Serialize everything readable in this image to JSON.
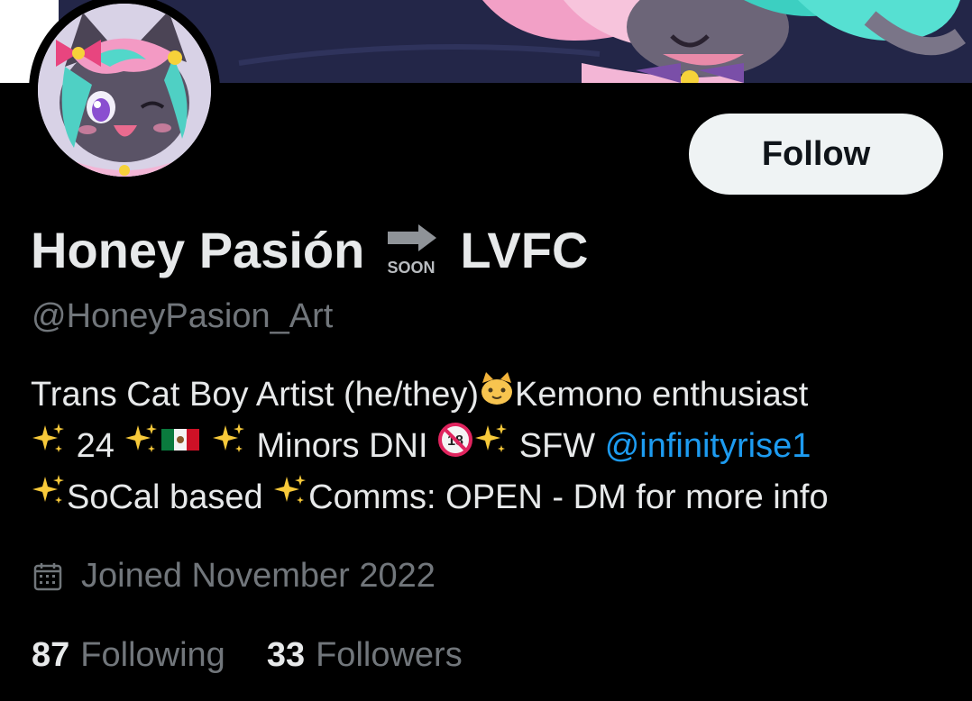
{
  "profile": {
    "display_name_part1": "Honey Pasión",
    "soon_icon_text": "SOON",
    "display_name_part2": "LVFC",
    "handle": "@HoneyPasion_Art",
    "follow_label": "Follow"
  },
  "bio": {
    "line1_text": "Trans Cat Boy Artist (he/they)",
    "line1_emoji": "cat-face",
    "line1_tail": "Kemono enthusiast",
    "line2_age": "24",
    "line2_emoji_flag": "mexico-flag",
    "line2_dni": "Minors DNI",
    "line2_emoji_18": "no-one-under-eighteen",
    "line2_no18_text": "18",
    "line2_sfw": "SFW",
    "line2_mention": "@infinityrise1",
    "line3_a": "SoCal based",
    "line3_b": "Comms: OPEN - DM for more info",
    "sparkle_emoji": "sparkles"
  },
  "joined": {
    "icon": "calendar-icon",
    "text": "Joined November 2022"
  },
  "stats": {
    "following_count": "87",
    "following_label": "Following",
    "followers_count": "33",
    "followers_label": "Followers"
  },
  "colors": {
    "background": "#000000",
    "primary_text": "#e7e9ea",
    "secondary_text": "#71767b",
    "link": "#1d9bf0",
    "button_bg": "#eff3f4"
  }
}
